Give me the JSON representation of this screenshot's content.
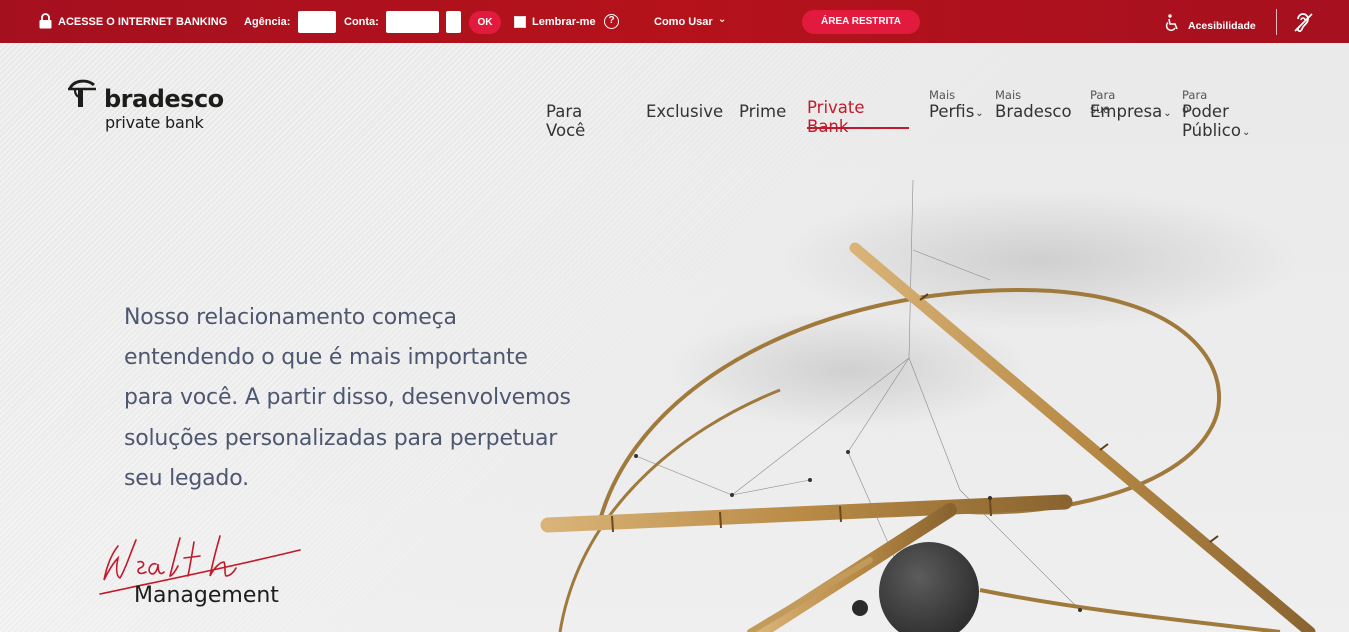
{
  "topbar": {
    "internet_banking": "ACESSE O INTERNET BANKING",
    "agencia_label": "Agência:",
    "conta_label": "Conta:",
    "ok_label": "OK",
    "lembrar_label": "Lembrar-me",
    "help_glyph": "?",
    "como_usar": "Como Usar",
    "como_usar_chevron": "⌄",
    "area_restrita": "ÁREA RESTRITA",
    "acessibilidade": "Acesibilidade",
    "icons": [
      "lock-icon",
      "help-icon",
      "accessibility-icon",
      "hearing-icon"
    ],
    "background_color": "#b5121b",
    "button_color": "#e11a3e"
  },
  "logo": {
    "brand": "bradesco",
    "sub": "private bank"
  },
  "nav": {
    "para_voce": "Para Você",
    "exclusive": "Exclusive",
    "prime": "Prime",
    "private_bank": "Private Bank",
    "mais_perfis_small": "Mais",
    "mais_perfis": "Perfis",
    "mais_bradesco_small": "Mais",
    "mais_bradesco": "Bradesco",
    "empresa_small": "Para sua",
    "empresa": "Empresa",
    "poder_small": "Para o",
    "poder": "Poder Público",
    "chevron": "⌄",
    "active_color": "#c2192b"
  },
  "hero": {
    "lines": [
      "Nosso relacionamento começa",
      "entendendo o que é mais importante",
      "para você. A partir disso, desenvolvemos",
      "soluções personalizadas para perpetuar",
      "seu legado."
    ],
    "text_color": "#4d5870"
  },
  "wealth": {
    "management": "Management",
    "accent_color": "#c2192b"
  }
}
